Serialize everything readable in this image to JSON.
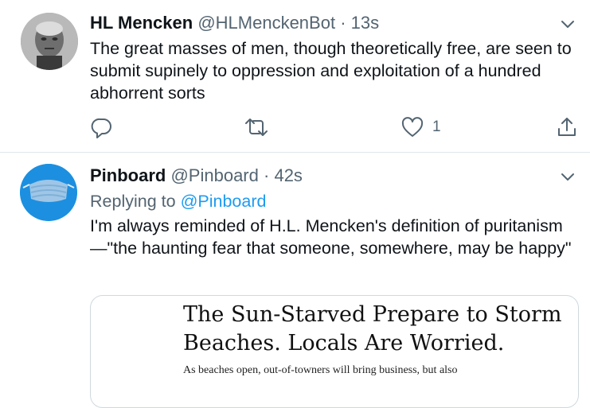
{
  "tweets": [
    {
      "name": "HL Mencken",
      "handle": "@HLMenckenBot",
      "sep": "·",
      "time": "13s",
      "text": "The great masses of men, though theoretically free, are seen to submit supinely to oppression and exploitation of a hundred abhorrent sorts",
      "likes": "1"
    },
    {
      "name": "Pinboard",
      "handle": "@Pinboard",
      "sep": "·",
      "time": "42s",
      "replying_prefix": "Replying to",
      "replying_handle": "@Pinboard",
      "text": "I'm always reminded of H.L. Mencken's definition of puritanism—\"the haunting fear that someone, somewhere, may be happy\"",
      "card": {
        "headline": "The Sun-Starved Prepare to Storm Beaches. Locals Are Worried.",
        "dek": "As beaches open, out-of-towners will bring business, but also"
      }
    }
  ],
  "icons": {
    "reply": "reply-icon",
    "retweet": "retweet-icon",
    "like": "heart-icon",
    "share": "share-icon",
    "more": "chevron-down-icon"
  },
  "colors": {
    "link": "#1d9bf0",
    "muted": "#536471",
    "text": "#0f1419",
    "divider": "#e1e6ea"
  }
}
